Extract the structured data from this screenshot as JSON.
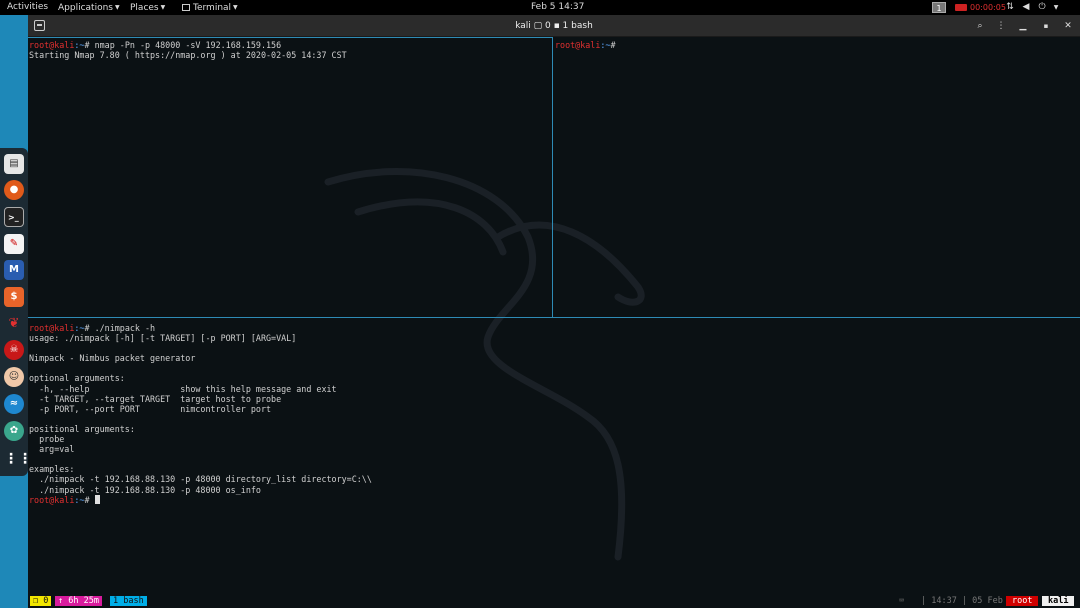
{
  "topbar": {
    "activities": "Activities",
    "applications": "Applications",
    "places": "Places",
    "terminal": "Terminal",
    "clock": "Feb 5  14:37",
    "workspace": "1",
    "recording_time": "00:00:05"
  },
  "window": {
    "title": "kali ▢ 0 ▪ 1 bash"
  },
  "panes": {
    "top_left": [
      {
        "user": "root@kali",
        "path": ":~",
        "cmd": "# nmap -Pn -p 48000 -sV 192.168.159.156"
      },
      {
        "text": "Starting Nmap 7.80 ( https://nmap.org ) at 2020-02-05 14:37 CST"
      }
    ],
    "top_right": [
      {
        "user": "root@kali",
        "path": ":~",
        "cmd": "#"
      }
    ],
    "bottom": [
      {
        "user": "root@kali",
        "path": ":~",
        "cmd": "# ./nimpack -h"
      },
      {
        "text": "usage: ./nimpack [-h] [-t TARGET] [-p PORT] [ARG=VAL]"
      },
      {
        "text": ""
      },
      {
        "text": "Nimpack - Nimbus packet generator"
      },
      {
        "text": ""
      },
      {
        "text": "optional arguments:"
      },
      {
        "text": "  -h, --help                  show this help message and exit"
      },
      {
        "text": "  -t TARGET, --target TARGET  target host to probe"
      },
      {
        "text": "  -p PORT, --port PORT        nimcontroller port"
      },
      {
        "text": ""
      },
      {
        "text": "positional arguments:"
      },
      {
        "text": "  probe"
      },
      {
        "text": "  arg=val"
      },
      {
        "text": ""
      },
      {
        "text": "examples:"
      },
      {
        "text": "  ./nimpack -t 192.168.88.130 -p 48000 directory_list directory=C:\\\\"
      },
      {
        "text": "  ./nimpack -t 192.168.88.130 -p 48000 os_info"
      },
      {
        "user": "root@kali",
        "path": ":~",
        "cmd": "# ",
        "cursor": true
      }
    ]
  },
  "tmux": {
    "session": "❐ 0",
    "uptime": "↑ 6h 25m",
    "window": "1 bash",
    "mode": "⌨",
    "time": "| 14:37 | 05 Feb",
    "user": "root",
    "host": "kali",
    "colors": {
      "session_bg": "#f2e600",
      "uptime_bg": "#d81b9d",
      "window_bg": "#00aee8",
      "user_bg": "#d00000",
      "host_bg": "#f0f0f0"
    }
  },
  "dock": {
    "icons": [
      "files-icon",
      "firefox-icon",
      "terminal-icon",
      "leafpad-icon",
      "metasploit-icon",
      "burpsuite-icon",
      "cherrytree-icon",
      "armitage-icon",
      "maltego-icon",
      "wireshark-icon",
      "faraday-icon",
      "show-apps-icon"
    ]
  }
}
